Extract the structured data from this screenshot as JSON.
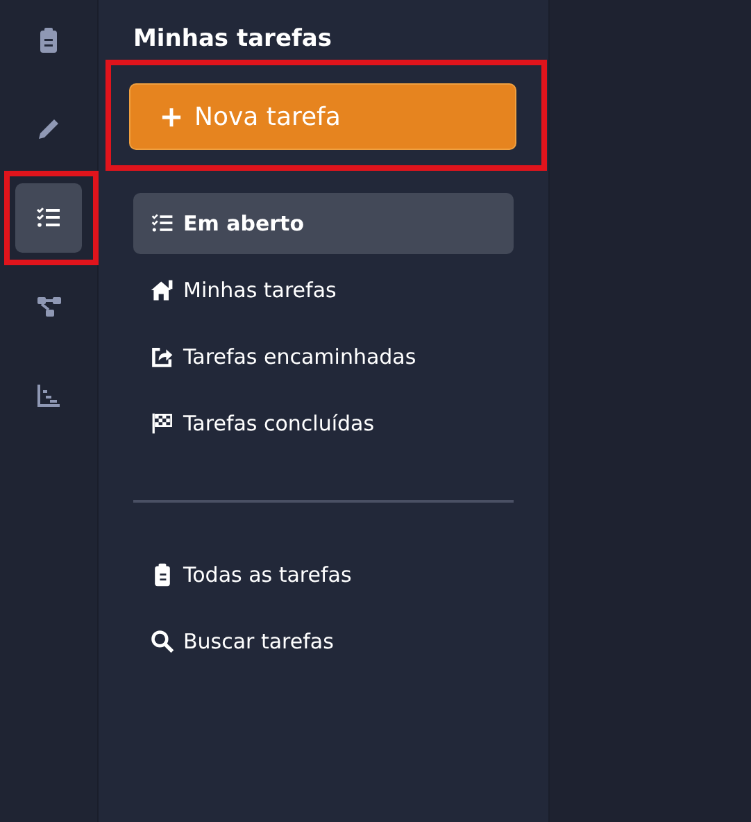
{
  "rail": [
    {
      "kind": "clipboard",
      "selected": false,
      "highlighted": false
    },
    {
      "kind": "pencil",
      "selected": false,
      "highlighted": false
    },
    {
      "kind": "checklist",
      "selected": true,
      "highlighted": true
    },
    {
      "kind": "nodes",
      "selected": false,
      "highlighted": false
    },
    {
      "kind": "chart",
      "selected": false,
      "highlighted": false
    }
  ],
  "panel": {
    "title": "Minhas tarefas",
    "new_button": {
      "label": "Nova tarefa",
      "highlighted": true
    },
    "nav": [
      {
        "label": "Em aberto",
        "kind": "checklist",
        "selected": true
      },
      {
        "label": "Minhas tarefas",
        "kind": "house",
        "selected": false
      },
      {
        "label": "Tarefas encaminhadas",
        "kind": "share",
        "selected": false
      },
      {
        "label": "Tarefas concluídas",
        "kind": "flag",
        "selected": false
      }
    ],
    "nav_bottom": [
      {
        "label": "Todas as tarefas",
        "kind": "clipboard",
        "selected": false
      },
      {
        "label": "Buscar tarefas",
        "kind": "search",
        "selected": false
      }
    ]
  }
}
